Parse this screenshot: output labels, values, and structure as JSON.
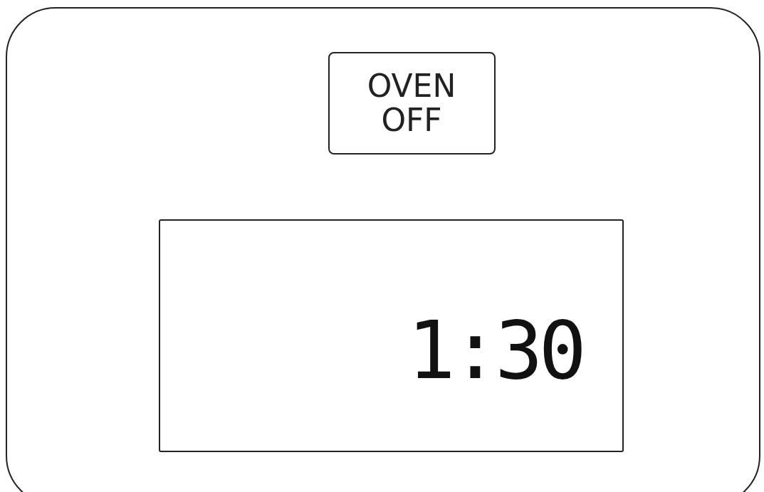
{
  "oven_off_button": {
    "label": "OVEN OFF"
  },
  "display": {
    "time": "1:30"
  }
}
